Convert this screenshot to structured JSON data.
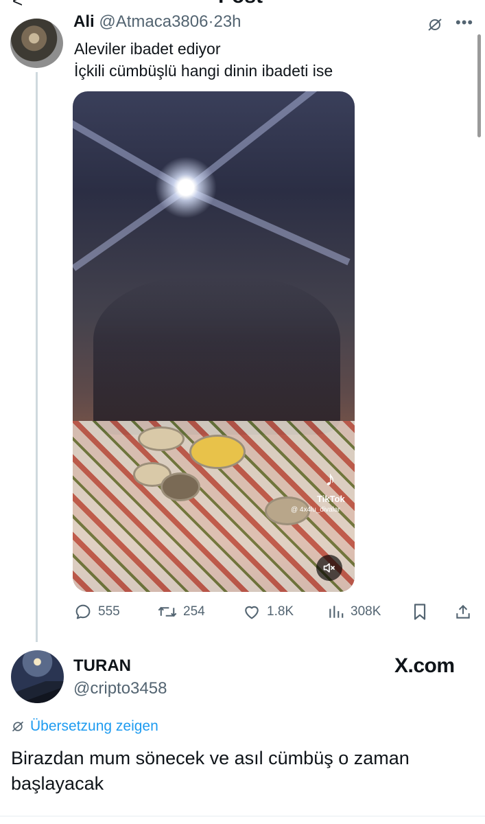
{
  "header": {
    "back_glyph": "<",
    "title": "Post"
  },
  "tweet": {
    "display_name": "Ali",
    "handle": "@Atmaca3806",
    "separator": "·",
    "time": "23h",
    "lines": [
      "Aleviler ibadet ediyor",
      "İçkili cümbüşlü hangi dinin ibadeti ise"
    ],
    "media": {
      "watermark_brand": "TikTok",
      "watermark_handle": "@ 4x4lu_divalar",
      "mute_icon": "mute-icon"
    },
    "actions": {
      "replies": "555",
      "reposts": "254",
      "likes": "1.8K",
      "views": "308K"
    }
  },
  "quote": {
    "display_name": "TURAN",
    "handle": "@cripto3458",
    "brand": "X.com",
    "translate_label": "Übersetzung zeigen",
    "text": "Birazdan mum sönecek ve asıl cümbüş o zaman başlayacak"
  },
  "colors": {
    "text": "#0f1419",
    "secondary": "#536471",
    "accent": "#1d9bf0",
    "thread_line": "#cfd9de"
  }
}
